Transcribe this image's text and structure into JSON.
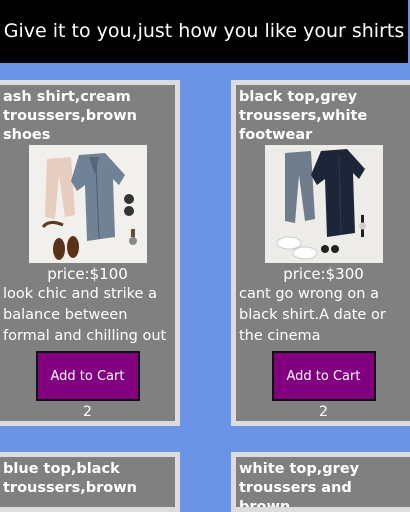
{
  "header": {
    "title": "Give it to you,just how you like your shirts"
  },
  "products": [
    {
      "title": "ash shirt,cream troussers,brown shoes",
      "image_icon": "outfit-ash-shirt-photo",
      "price": "price:$100",
      "description": "look chic and strike a balance between formal and chilling out",
      "button_label": "Add to Cart",
      "quantity": "2"
    },
    {
      "title": "black top,grey troussers,white footwear",
      "image_icon": "outfit-black-top-photo",
      "price": "price:$300",
      "description": "cant go wrong on a black shirt.A date or the cinema",
      "button_label": "Add to Cart",
      "quantity": "2"
    },
    {
      "title": "blue top,black troussers,brown"
    },
    {
      "title": "white top,grey troussers and brown"
    }
  ],
  "colors": {
    "page_background": "#6a93e6",
    "header_background": "#000000",
    "card_background": "#808080",
    "card_border": "#dcdcdc",
    "button_background": "#800080"
  }
}
